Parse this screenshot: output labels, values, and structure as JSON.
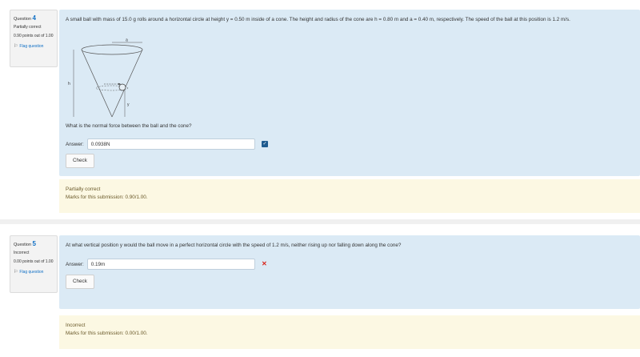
{
  "questions": [
    {
      "label": "Question",
      "number": "4",
      "state": "Partially correct",
      "grade": "0.90 points out of 1.00",
      "flag": "Flag question",
      "text": "A small ball with mass of 15.0 g rolls around a horizontal circle at height y = 0.50 m inside of a cone. The height and radius of the cone are h = 0.80 m and a = 0.40 m, respectively. The speed of the ball at this position is 1.2 m/s.",
      "figure_labels": {
        "a": "a",
        "h": "h",
        "y": "y"
      },
      "prompt": "What is the normal force between the ball and the cone?",
      "answer_label": "Answer:",
      "answer_value": "0.0938N",
      "check_label": "Check",
      "outcome_title": "Partially correct",
      "outcome_marks": "Marks for this submission: 0.90/1.00."
    },
    {
      "label": "Question",
      "number": "5",
      "state": "Incorrect",
      "grade": "0.00 points out of 1.00",
      "flag": "Flag question",
      "text": "At what vertical position y would the ball move in a perfect horizontal circle with the speed of 1.2 m/s, neither rising up nor falling down along the cone?",
      "answer_label": "Answer:",
      "answer_value": "0.19m",
      "check_label": "Check",
      "outcome_title": "Incorrect",
      "outcome_marks": "Marks for this submission: 0.00/1.00."
    }
  ],
  "colors": {
    "formulation_bg": "#dbeaf5",
    "outcome_bg": "#fcf8e3",
    "link": "#0f6fc5",
    "incorrect": "#d9261c"
  },
  "icons": {
    "flag": "flag-icon",
    "correct": "check-square-icon",
    "incorrect": "cross-icon"
  }
}
